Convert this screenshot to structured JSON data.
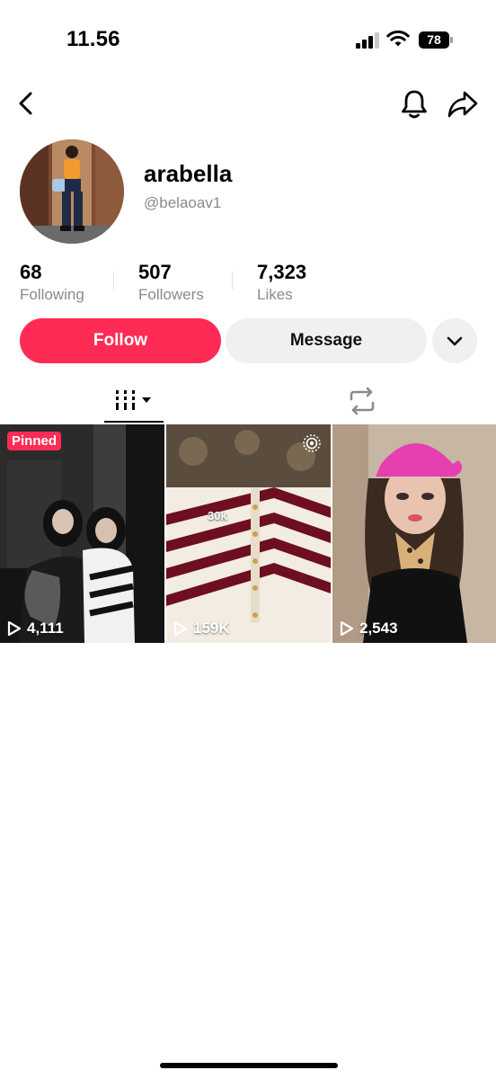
{
  "status_bar": {
    "time": "11.56",
    "battery": "78"
  },
  "profile": {
    "display_name": "arabella",
    "handle": "@belaoav1"
  },
  "stats": [
    {
      "value": "68",
      "label": "Following"
    },
    {
      "value": "507",
      "label": "Followers"
    },
    {
      "value": "7,323",
      "label": "Likes"
    }
  ],
  "actions": {
    "follow": "Follow",
    "message": "Message"
  },
  "videos": [
    {
      "views": "4,111",
      "pinned_label": "Pinned"
    },
    {
      "views": "159K",
      "overlay": "30k"
    },
    {
      "views": "2,543"
    }
  ],
  "colors": {
    "accent": "#fe2c55",
    "secondary_button": "#f0f0f0",
    "muted_text": "#8a8a8a"
  },
  "icons": [
    "back-icon",
    "bell-icon",
    "share-icon",
    "chevron-down-icon",
    "grid-icon",
    "repost-icon",
    "play-icon"
  ]
}
